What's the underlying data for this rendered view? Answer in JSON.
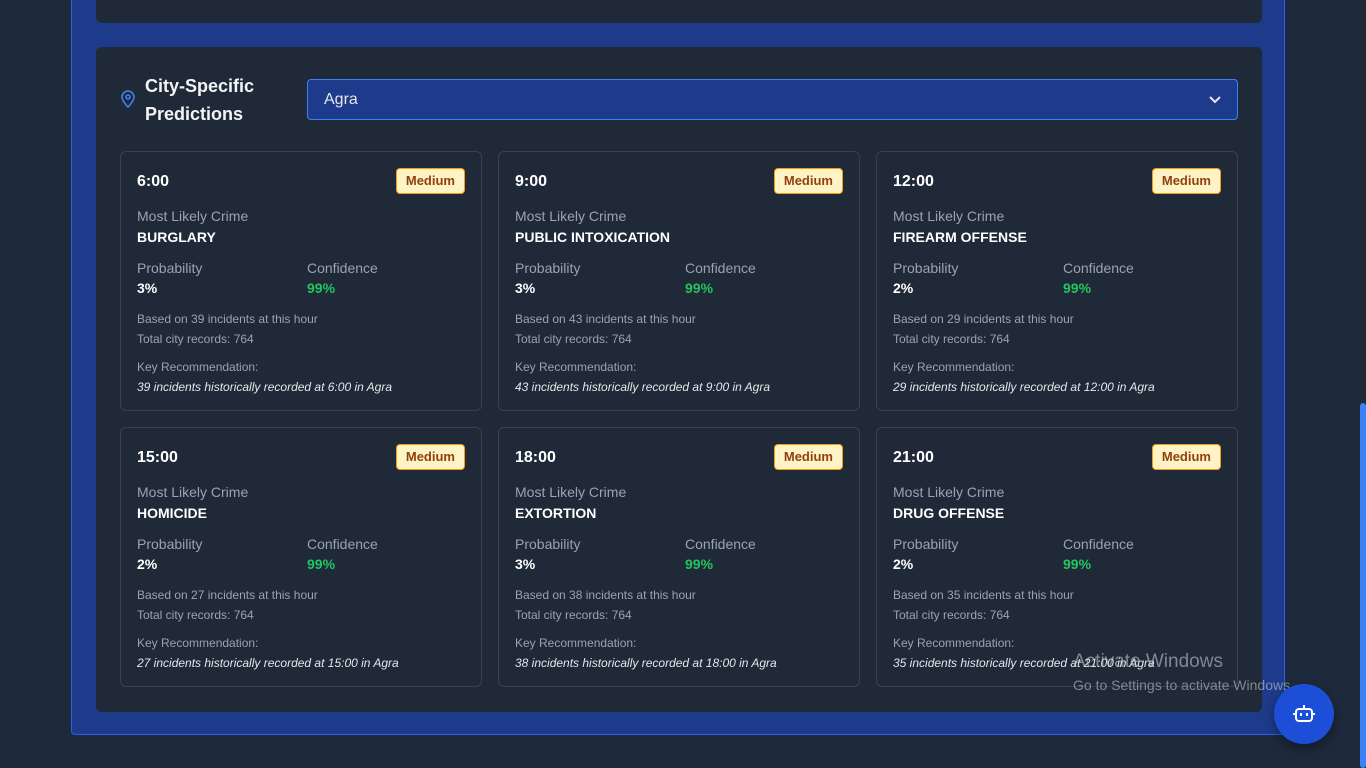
{
  "section": {
    "title": "City-Specific Predictions",
    "selected_city": "Agra"
  },
  "labels": {
    "most_likely": "Most Likely Crime",
    "probability": "Probability",
    "confidence": "Confidence",
    "key_rec": "Key Recommendation:"
  },
  "cards": [
    {
      "time": "6:00",
      "risk": "Medium",
      "crime": "BURGLARY",
      "probability": "3%",
      "confidence": "99%",
      "based_on": "Based on 39 incidents at this hour",
      "total": "Total city records: 764",
      "recommendation": "39 incidents historically recorded at 6:00 in Agra"
    },
    {
      "time": "9:00",
      "risk": "Medium",
      "crime": "PUBLIC INTOXICATION",
      "probability": "3%",
      "confidence": "99%",
      "based_on": "Based on 43 incidents at this hour",
      "total": "Total city records: 764",
      "recommendation": "43 incidents historically recorded at 9:00 in Agra"
    },
    {
      "time": "12:00",
      "risk": "Medium",
      "crime": "FIREARM OFFENSE",
      "probability": "2%",
      "confidence": "99%",
      "based_on": "Based on 29 incidents at this hour",
      "total": "Total city records: 764",
      "recommendation": "29 incidents historically recorded at 12:00 in Agra"
    },
    {
      "time": "15:00",
      "risk": "Medium",
      "crime": "HOMICIDE",
      "probability": "2%",
      "confidence": "99%",
      "based_on": "Based on 27 incidents at this hour",
      "total": "Total city records: 764",
      "recommendation": "27 incidents historically recorded at 15:00 in Agra"
    },
    {
      "time": "18:00",
      "risk": "Medium",
      "crime": "EXTORTION",
      "probability": "3%",
      "confidence": "99%",
      "based_on": "Based on 38 incidents at this hour",
      "total": "Total city records: 764",
      "recommendation": "38 incidents historically recorded at 18:00 in Agra"
    },
    {
      "time": "21:00",
      "risk": "Medium",
      "crime": "DRUG OFFENSE",
      "probability": "2%",
      "confidence": "99%",
      "based_on": "Based on 35 incidents at this hour",
      "total": "Total city records: 764",
      "recommendation": "35 incidents historically recorded at 21:00 in Agra"
    }
  ],
  "watermark": {
    "title": "Activate Windows",
    "subtitle": "Go to Settings to activate Windows."
  },
  "icons": {
    "section": "map-pin-icon",
    "select": "chevron-down-icon",
    "assistant": "robot-icon"
  },
  "colors": {
    "accent": "#3b82f6",
    "badge_bg": "#fef3c7",
    "badge_text": "#92400e",
    "confidence": "#22c55e"
  }
}
